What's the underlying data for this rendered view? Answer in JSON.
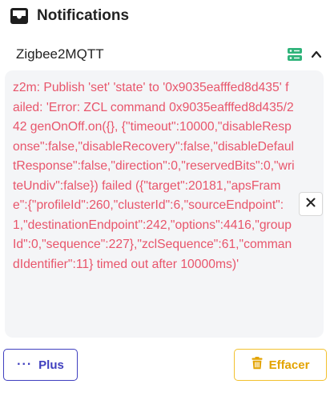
{
  "header": {
    "title": "Notifications",
    "icon": "inbox-icon"
  },
  "section": {
    "name": "Zigbee2MQTT",
    "icons": [
      "server-icon",
      "chevron-up-icon"
    ]
  },
  "notification": {
    "message": "z2m: Publish 'set' 'state' to '0x9035eafffed8d435' failed: 'Error: ZCL command 0x9035eafffed8d435/242 genOnOff.on({}, {\"timeout\":10000,\"disableResponse\":false,\"disableRecovery\":false,\"disableDefaultResponse\":false,\"direction\":0,\"reservedBits\":0,\"writeUndiv\":false}) failed ({\"target\":20181,\"apsFrame\":{\"profileId\":260,\"clusterId\":6,\"sourceEndpoint\":1,\"destinationEndpoint\":242,\"options\":4416,\"groupId\":0,\"sequence\":227},\"zclSequence\":61,\"commandIdentifier\":11} timed out after 10000ms)'",
    "color": "#e8556b"
  },
  "buttons": {
    "more_icon": "···",
    "more_label": "Plus",
    "clear_label": "Effacer"
  },
  "colors": {
    "primary": "#3f3fbf",
    "warning": "#f2c12e",
    "success": "#2fb37a"
  }
}
